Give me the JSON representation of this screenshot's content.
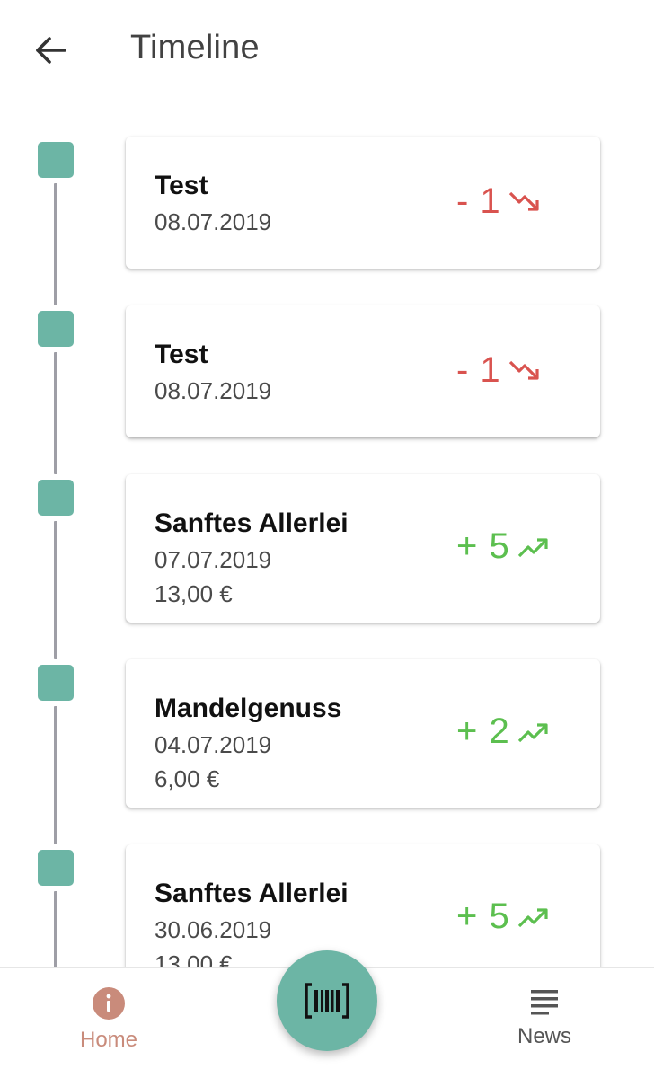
{
  "header": {
    "title": "Timeline",
    "back_icon": "arrow-back-icon"
  },
  "timeline": {
    "entries": [
      {
        "name": "Test",
        "date": "08.07.2019",
        "price": "",
        "delta": "- 1",
        "trend": "down"
      },
      {
        "name": "Test",
        "date": "08.07.2019",
        "price": "",
        "delta": "- 1",
        "trend": "down"
      },
      {
        "name": "Sanftes Allerlei",
        "date": "07.07.2019",
        "price": "13,00 €",
        "delta": "+ 5",
        "trend": "up"
      },
      {
        "name": "Mandelgenuss",
        "date": "04.07.2019",
        "price": "6,00 €",
        "delta": "+ 2",
        "trend": "up"
      },
      {
        "name": "Sanftes Allerlei",
        "date": "30.06.2019",
        "price": "13,00 €",
        "delta": "+ 5",
        "trend": "up"
      }
    ]
  },
  "bottom_nav": {
    "home_label": "Home",
    "home_icon": "info-icon",
    "news_label": "News",
    "news_icon": "news-lines-icon",
    "scan_icon": "barcode-scan-icon"
  },
  "colors": {
    "accent": "#6cb5a5",
    "negative": "#d9534f",
    "positive": "#5cbf4f",
    "home_active": "#c98b7b",
    "rail": "#9e9ea6"
  }
}
